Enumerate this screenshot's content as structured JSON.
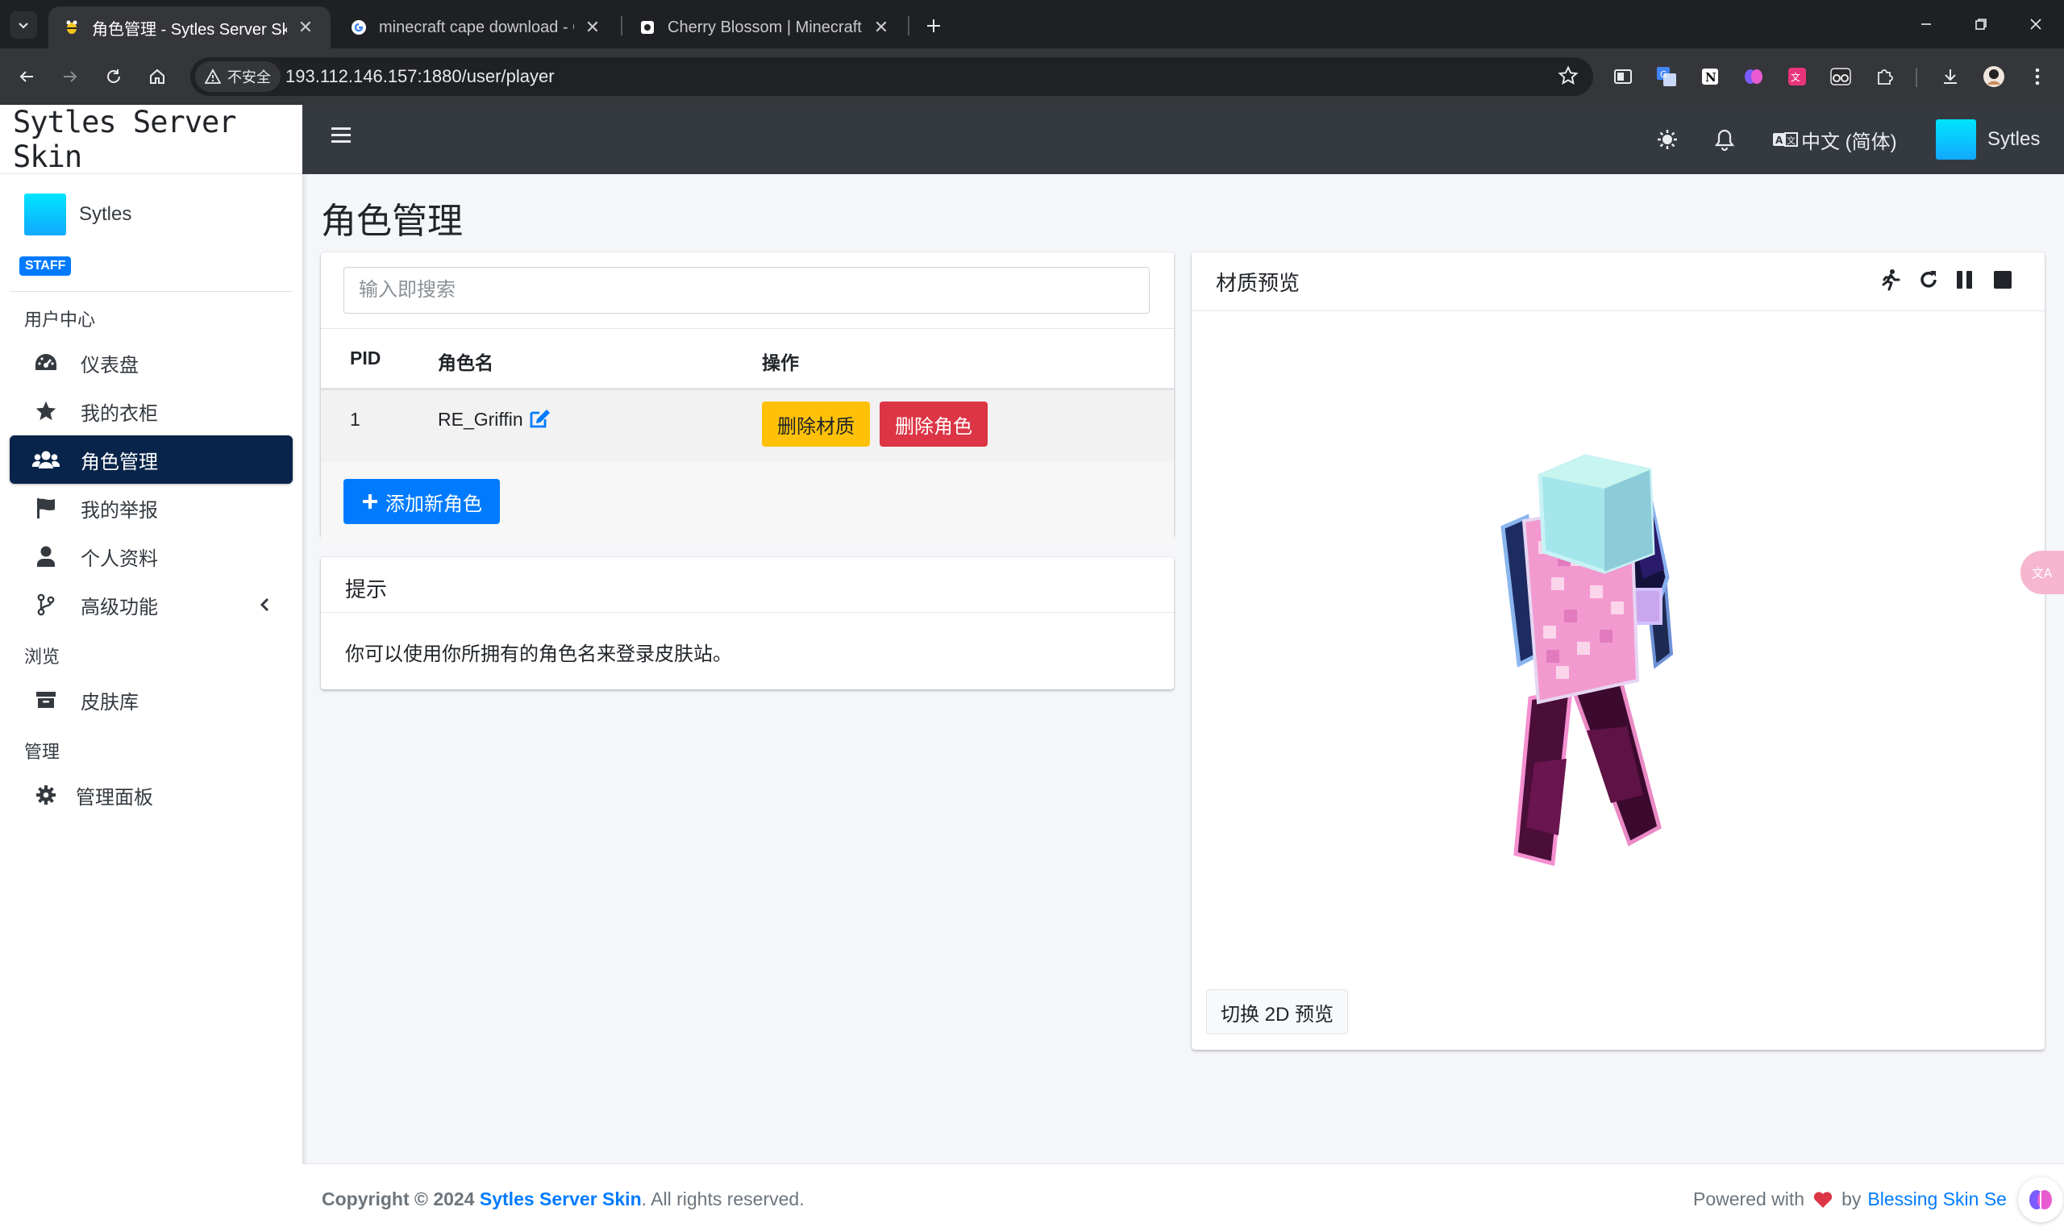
{
  "browser": {
    "tabs": [
      {
        "title": "角色管理 - Sytles Server Skin",
        "active": true
      },
      {
        "title": "minecraft cape download - G",
        "active": false
      },
      {
        "title": "Cherry Blossom | Minecraft C",
        "active": false
      }
    ],
    "security_label": "不安全",
    "url": "193.112.146.157:1880/user/player"
  },
  "sidebar": {
    "brand": "Sytles Server Skin",
    "user_name": "Sytles",
    "badge": "STAFF",
    "section_user": "用户中心",
    "items": [
      {
        "label": "仪表盘",
        "icon": "dashboard-icon"
      },
      {
        "label": "我的衣柜",
        "icon": "star-icon"
      },
      {
        "label": "角色管理",
        "icon": "users-icon",
        "active": true
      },
      {
        "label": "我的举报",
        "icon": "flag-icon"
      },
      {
        "label": "个人资料",
        "icon": "user-icon"
      },
      {
        "label": "高级功能",
        "icon": "code-branch-icon"
      }
    ],
    "section_browse": "浏览",
    "browse_items": [
      {
        "label": "皮肤库",
        "icon": "archive-icon"
      }
    ],
    "section_admin": "管理",
    "admin_items": [
      {
        "label": "管理面板",
        "icon": "gear-icon"
      }
    ]
  },
  "topnav": {
    "language": "中文 (简体)",
    "user_name": "Sytles"
  },
  "page": {
    "title": "角色管理"
  },
  "players": {
    "search_placeholder": "输入即搜索",
    "columns": [
      "PID",
      "角色名",
      "操作"
    ],
    "rows": [
      {
        "pid": "1",
        "name": "RE_Griffin",
        "delete_texture": "删除材质",
        "delete_player": "删除角色"
      }
    ],
    "add_button": "添加新角色"
  },
  "tip": {
    "title": "提示",
    "body": "你可以使用你所拥有的角色名来登录皮肤站。"
  },
  "preview": {
    "title": "材质预览",
    "switch_button": "切换 2D 预览",
    "background_options": [
      "white",
      "black",
      "gray"
    ]
  },
  "footer": {
    "copyright_prefix": "Copyright © 2024",
    "site_name": "Sytles Server Skin",
    "rights": ". All rights reserved.",
    "powered_prefix": "Powered with",
    "powered_by": "by",
    "powered_link": "Blessing Skin Se"
  },
  "colors": {
    "primary": "#007bff",
    "warning": "#ffc107",
    "danger": "#dc3545",
    "success": "#28a745",
    "sidebar_active": "#08244a",
    "topnav": "#343a40"
  }
}
